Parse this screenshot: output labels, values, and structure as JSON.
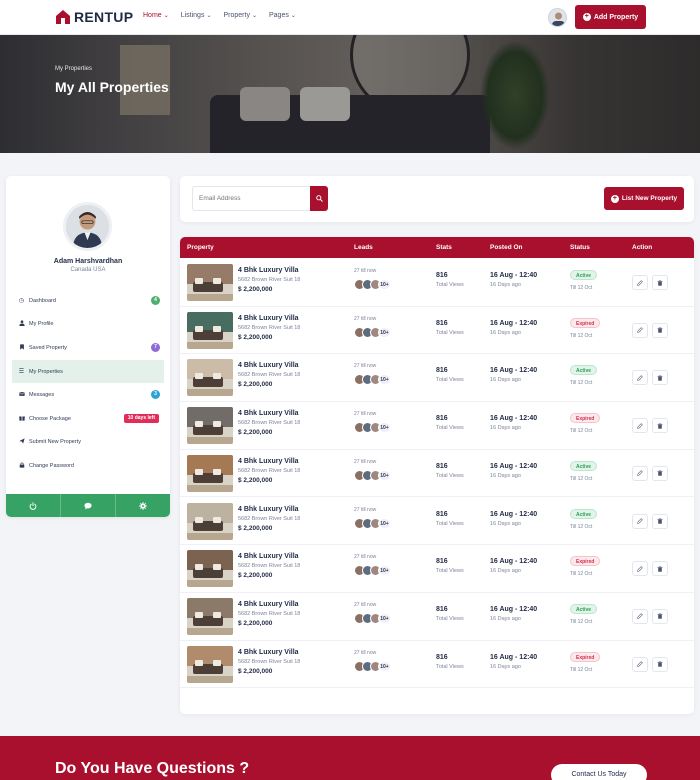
{
  "header": {
    "logo": "RENTUP",
    "nav": [
      {
        "label": "Home",
        "active": true
      },
      {
        "label": "Listings",
        "active": false
      },
      {
        "label": "Property",
        "active": false
      },
      {
        "label": "Pages",
        "active": false
      }
    ],
    "add_property_label": "Add Property"
  },
  "hero": {
    "breadcrumb": "My Properties",
    "title": "My All Properties"
  },
  "profile": {
    "name": "Adam Harshvardhan",
    "location": "Canada USA"
  },
  "sidebar": {
    "items": [
      {
        "label": "Dashboard",
        "icon": "dashboard-icon",
        "glyph": "◷",
        "badge": "4",
        "badge_color": "green"
      },
      {
        "label": "My Profile",
        "icon": "user-icon",
        "glyph": "👤",
        "badge": "",
        "badge_color": ""
      },
      {
        "label": "Saved Property",
        "icon": "bookmark-icon",
        "glyph": "▮",
        "badge": "7",
        "badge_color": "purple"
      },
      {
        "label": "My Properties",
        "icon": "list-icon",
        "glyph": "☰",
        "badge": "",
        "badge_color": "",
        "active": true
      },
      {
        "label": "Messages",
        "icon": "envelope-icon",
        "glyph": "✉",
        "badge": "3",
        "badge_color": "blue"
      },
      {
        "label": "Choose Package",
        "icon": "gift-icon",
        "glyph": "🎁",
        "badge": "10 days left",
        "badge_color": "red"
      },
      {
        "label": "Submit New Property",
        "icon": "send-icon",
        "glyph": "✈",
        "badge": "",
        "badge_color": ""
      },
      {
        "label": "Change Password",
        "icon": "lock-icon",
        "glyph": "🔒",
        "badge": "",
        "badge_color": ""
      }
    ]
  },
  "search": {
    "placeholder": "Email Address",
    "list_new_label": "List New Property"
  },
  "table": {
    "headers": [
      "Property",
      "Leads",
      "Stats",
      "Posted On",
      "Status",
      "Action"
    ],
    "rows": [
      {
        "title": "4 Bhk Luxury Villa",
        "address": "5682 Brown River Suit 18",
        "price": "$ 2,200,000",
        "leads_label": "27 till now",
        "leads_more": "10+",
        "stat": "816",
        "stat_label": "Total Views",
        "posted": "16 Aug - 12:40",
        "ago": "16 Days ago",
        "status": "Active",
        "till": "Till 12 Oct",
        "thumb": "#8a6d57"
      },
      {
        "title": "4 Bhk Luxury Villa",
        "address": "5682 Brown River Suit 18",
        "price": "$ 2,200,000",
        "leads_label": "27 till now",
        "leads_more": "10+",
        "stat": "816",
        "stat_label": "Total Views",
        "posted": "16 Aug - 12:40",
        "ago": "16 Days ago",
        "status": "Expired",
        "till": "Till 12 Oct",
        "thumb": "#2f5a4e"
      },
      {
        "title": "4 Bhk Luxury Villa",
        "address": "5682 Brown River Suit 18",
        "price": "$ 2,200,000",
        "leads_label": "27 till now",
        "leads_more": "10+",
        "stat": "816",
        "stat_label": "Total Views",
        "posted": "16 Aug - 12:40",
        "ago": "16 Days ago",
        "status": "Active",
        "till": "Till 12 Oct",
        "thumb": "#c9b9a1"
      },
      {
        "title": "4 Bhk Luxury Villa",
        "address": "5682 Brown River Suit 18",
        "price": "$ 2,200,000",
        "leads_label": "27 till now",
        "leads_more": "10+",
        "stat": "816",
        "stat_label": "Total Views",
        "posted": "16 Aug - 12:40",
        "ago": "16 Days ago",
        "status": "Expired",
        "till": "Till 12 Oct",
        "thumb": "#5e5a56"
      },
      {
        "title": "4 Bhk Luxury Villa",
        "address": "5682 Brown River Suit 18",
        "price": "$ 2,200,000",
        "leads_label": "27 till now",
        "leads_more": "10+",
        "stat": "816",
        "stat_label": "Total Views",
        "posted": "16 Aug - 12:40",
        "ago": "16 Days ago",
        "status": "Active",
        "till": "Till 12 Oct",
        "thumb": "#9a6a3e"
      },
      {
        "title": "4 Bhk Luxury Villa",
        "address": "5682 Brown River Suit 18",
        "price": "$ 2,200,000",
        "leads_label": "27 till now",
        "leads_more": "10+",
        "stat": "816",
        "stat_label": "Total Views",
        "posted": "16 Aug - 12:40",
        "ago": "16 Days ago",
        "status": "Active",
        "till": "Till 12 Oct",
        "thumb": "#b7ab98"
      },
      {
        "title": "4 Bhk Luxury Villa",
        "address": "5682 Brown River Suit 18",
        "price": "$ 2,200,000",
        "leads_label": "27 till now",
        "leads_more": "10+",
        "stat": "816",
        "stat_label": "Total Views",
        "posted": "16 Aug - 12:40",
        "ago": "16 Days ago",
        "status": "Expired",
        "till": "Till 12 Oct",
        "thumb": "#6b4f3b"
      },
      {
        "title": "4 Bhk Luxury Villa",
        "address": "5682 Brown River Suit 18",
        "price": "$ 2,200,000",
        "leads_label": "27 till now",
        "leads_more": "10+",
        "stat": "816",
        "stat_label": "Total Views",
        "posted": "16 Aug - 12:40",
        "ago": "16 Days ago",
        "status": "Active",
        "till": "Till 12 Oct",
        "thumb": "#7d6a58"
      },
      {
        "title": "4 Bhk Luxury Villa",
        "address": "5682 Brown River Suit 18",
        "price": "$ 2,200,000",
        "leads_label": "27 till now",
        "leads_more": "10+",
        "stat": "816",
        "stat_label": "Total Views",
        "posted": "16 Aug - 12:40",
        "ago": "16 Days ago",
        "status": "Expired",
        "till": "Till 12 Oct",
        "thumb": "#a87f5c"
      }
    ]
  },
  "cta": {
    "title": "Do You Have Questions ?",
    "button": "Contact Us Today"
  },
  "colors": {
    "brand": "#a8102e",
    "green": "#36a365"
  }
}
